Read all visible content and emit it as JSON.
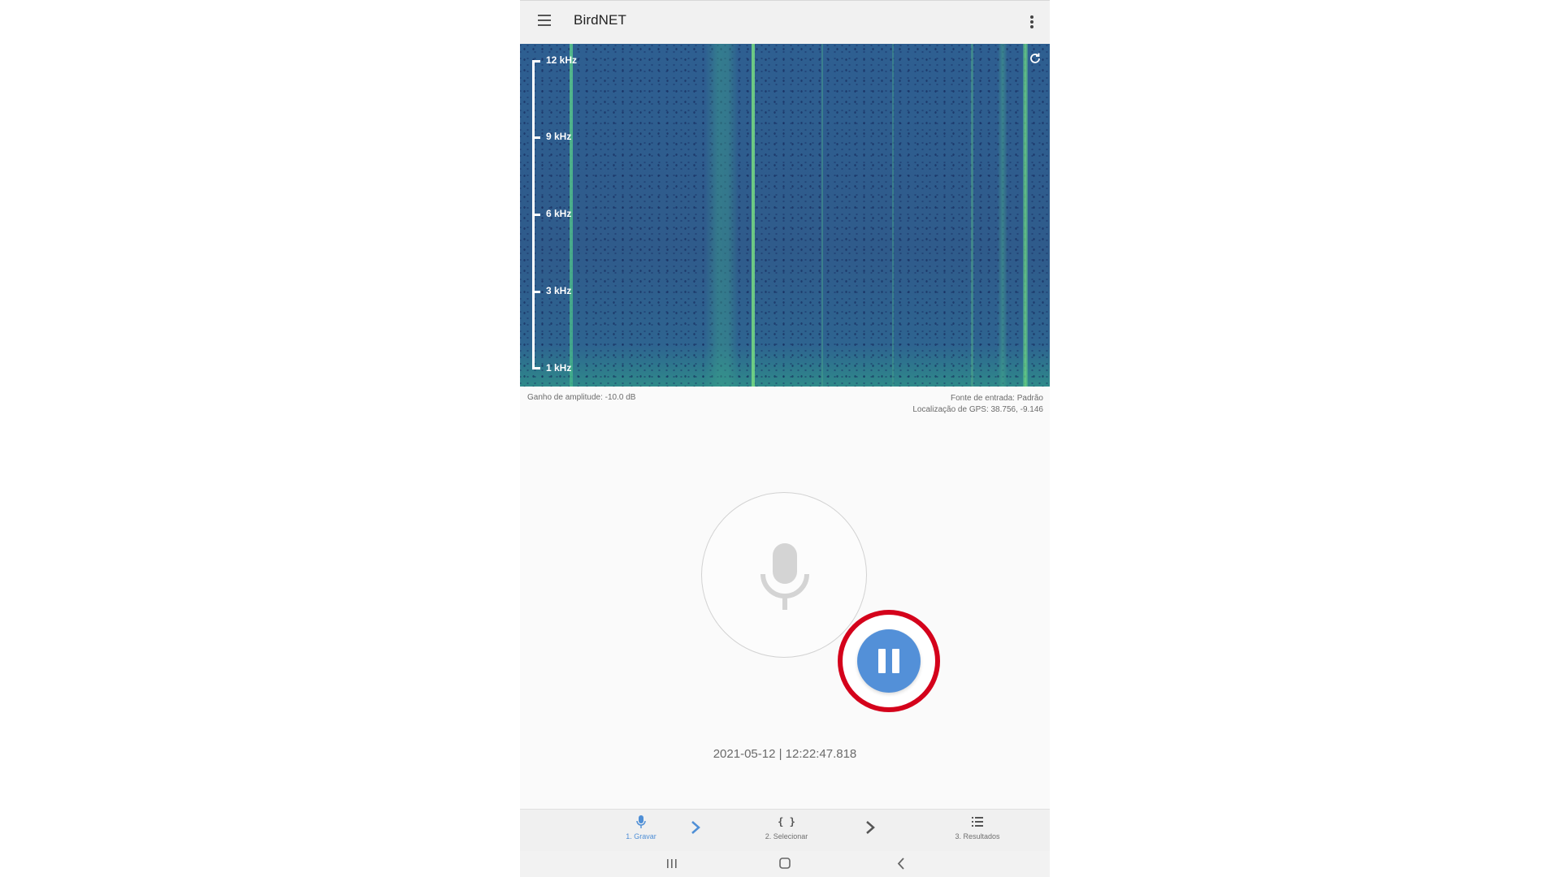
{
  "app": {
    "title": "BirdNET"
  },
  "spectrogram": {
    "freq_labels": [
      "12 kHz",
      "9 kHz",
      "6 kHz",
      "3 kHz",
      "1 kHz"
    ],
    "amplitude_gain": "Ganho de amplitude: -10.0 dB",
    "input_source": "Fonte de entrada: Padrão",
    "gps_location": "Localização de GPS: 38.756, -9.146"
  },
  "recording": {
    "timestamp": "2021-05-12 | 12:22:47.818",
    "state": "recording"
  },
  "bottom_nav": {
    "items": [
      {
        "label": "1. Gravar",
        "icon": "mic-icon",
        "active": true
      },
      {
        "label": "2. Selecionar",
        "icon": "braces-icon",
        "active": false
      },
      {
        "label": "3. Resultados",
        "icon": "list-icon",
        "active": false
      }
    ]
  },
  "colors": {
    "accent": "#5390d8",
    "highlight_ring": "#d4021b",
    "spectrogram_base": "#2e5f91"
  }
}
